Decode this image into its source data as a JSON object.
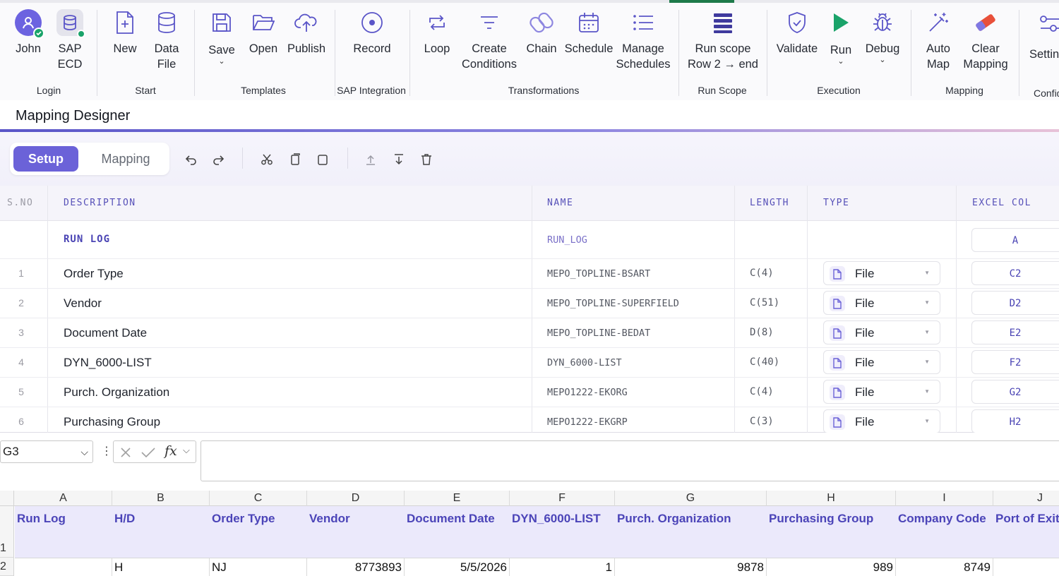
{
  "ribbon": {
    "groups": {
      "login": "Login",
      "start": "Start",
      "templates": "Templates",
      "sap_integration": "SAP Integration",
      "transformations": "Transformations",
      "run_scope": "Run Scope",
      "execution": "Execution",
      "mapping": "Mapping",
      "config": "Config"
    },
    "buttons": {
      "john": "John",
      "sap_ecd_1": "SAP",
      "sap_ecd_2": "ECD",
      "new": "New",
      "data_file_1": "Data",
      "data_file_2": "File",
      "save": "Save",
      "open": "Open",
      "publish": "Publish",
      "record": "Record",
      "loop": "Loop",
      "create_conditions_1": "Create",
      "create_conditions_2": "Conditions",
      "chain": "Chain",
      "schedule": "Schedule",
      "manage_schedules_1": "Manage",
      "manage_schedules_2": "Schedules",
      "run_scope_1": "Run scope",
      "run_scope_2": "Row 2 → end",
      "validate": "Validate",
      "run": "Run",
      "debug": "Debug",
      "auto_map_1": "Auto",
      "auto_map_2": "Map",
      "clear_mapping_1": "Clear",
      "clear_mapping_2": "Mapping",
      "settings": "Settings"
    },
    "icons": [
      "user-icon",
      "database-icon",
      "new-file-icon",
      "database-icon",
      "save-icon",
      "folder-open-icon",
      "cloud-upload-icon",
      "record-icon",
      "loop-icon",
      "filter-icon",
      "chain-link-icon",
      "calendar-icon",
      "list-icon",
      "stack-icon",
      "shield-check-icon",
      "play-icon",
      "bug-icon",
      "magic-wand-icon",
      "eraser-icon",
      "settings-sliders-icon"
    ],
    "colors": {
      "accent": "#6b62d8",
      "run_green": "#1aa36a",
      "eraser_red": "#e8503a"
    }
  },
  "designer": {
    "title": "Mapping Designer",
    "tabs": {
      "setup": "Setup",
      "mapping": "Mapping"
    },
    "toolbar_icons": [
      "undo-icon",
      "redo-icon",
      "cut-icon",
      "copy-icon",
      "paste-icon",
      "move-up-icon",
      "move-down-icon",
      "delete-icon"
    ]
  },
  "table": {
    "headers": {
      "sno": "S.NO",
      "description": "DESCRIPTION",
      "name": "NAME",
      "length": "LENGTH",
      "type": "TYPE",
      "excel_col": "EXCEL COL"
    },
    "run_log": {
      "description": "RUN LOG",
      "name": "RUN_LOG",
      "excel_col": "A"
    },
    "rows": [
      {
        "sno": "1",
        "description": "Order Type",
        "name": "MEPO_TOPLINE-BSART",
        "length": "C(4)",
        "type": "File",
        "excel_col": "C2"
      },
      {
        "sno": "2",
        "description": "Vendor",
        "name": "MEPO_TOPLINE-SUPERFIELD",
        "length": "C(51)",
        "type": "File",
        "excel_col": "D2"
      },
      {
        "sno": "3",
        "description": "Document Date",
        "name": "MEPO_TOPLINE-BEDAT",
        "length": "D(8)",
        "type": "File",
        "excel_col": "E2"
      },
      {
        "sno": "4",
        "description": "DYN_6000-LIST",
        "name": "DYN_6000-LIST",
        "length": "C(40)",
        "type": "File",
        "excel_col": "F2"
      },
      {
        "sno": "5",
        "description": "Purch. Organization",
        "name": "MEPO1222-EKORG",
        "length": "C(4)",
        "type": "File",
        "excel_col": "G2"
      },
      {
        "sno": "6",
        "description": "Purchasing Group",
        "name": "MEPO1222-EKGRP",
        "length": "C(3)",
        "type": "File",
        "excel_col": "H2"
      }
    ]
  },
  "excel": {
    "name_box": "G3",
    "formula": "",
    "col_letters": [
      "A",
      "B",
      "C",
      "D",
      "E",
      "F",
      "G",
      "H",
      "I",
      "J"
    ],
    "row_numbers": [
      "1",
      "2"
    ],
    "header_row": [
      "Run Log",
      "H/D",
      "Order Type",
      "Vendor",
      "Document Date",
      "DYN_6000-LIST",
      "Purch. Organization",
      "Purchasing Group",
      "Company Code",
      "Port of Exit"
    ],
    "data_row": [
      "",
      "H",
      "NJ",
      "8773893",
      "5/5/2026",
      "1",
      "9878",
      "989",
      "8749",
      ""
    ]
  }
}
